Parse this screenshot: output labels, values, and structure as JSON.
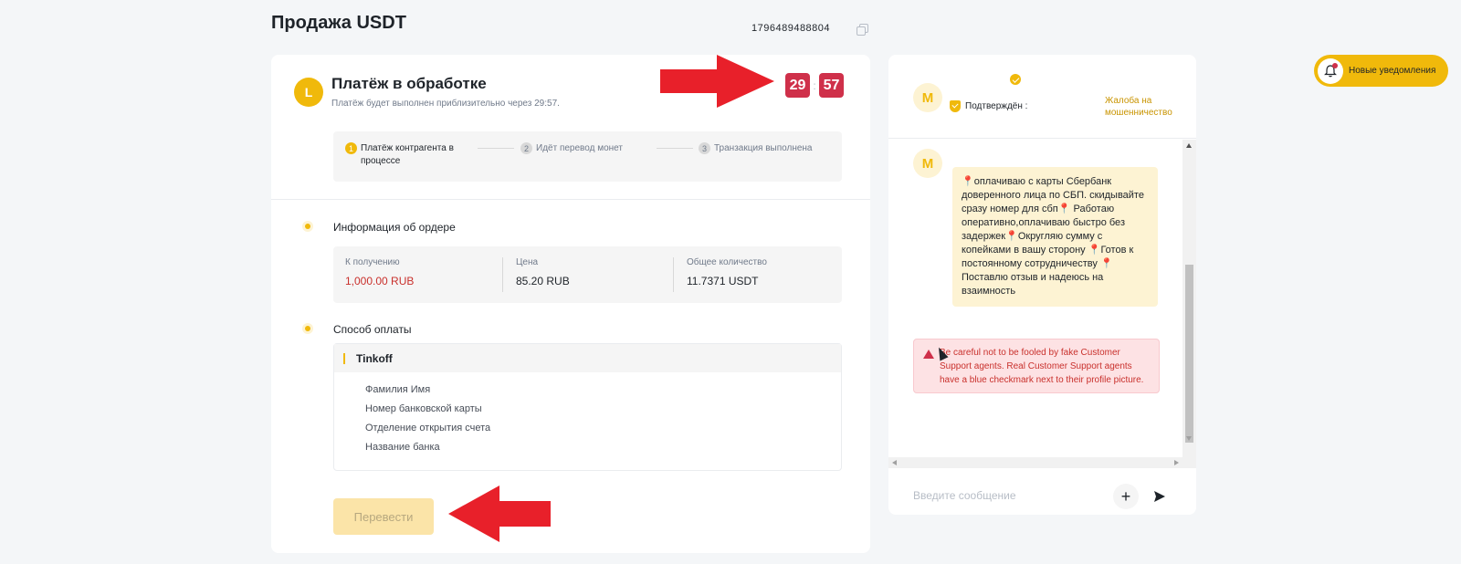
{
  "page": {
    "title": "Продажа USDT",
    "order_id": "1796489488804"
  },
  "status": {
    "avatar_letter": "L",
    "title": "Платёж в обработке",
    "subtitle": "Платёж будет выполнен приблизительно через 29:57.",
    "timer_minutes": "29",
    "timer_separator": ":",
    "timer_seconds": "57"
  },
  "steps": [
    {
      "num": "1",
      "label": "Платёж контрагента в процессе",
      "active": true
    },
    {
      "num": "2",
      "label": "Идёт перевод монет",
      "active": false
    },
    {
      "num": "3",
      "label": "Транзакция выполнена",
      "active": false
    }
  ],
  "order_info": {
    "title": "Информация об ордере",
    "receive_label": "К получению",
    "receive_value": "1,000.00 RUB",
    "price_label": "Цена",
    "price_value": "85.20 RUB",
    "total_label": "Общее количество",
    "total_value": "11.7371 USDT"
  },
  "payment": {
    "title": "Способ оплаты",
    "method": "Tinkoff",
    "fields": [
      "Фамилия Имя",
      "Номер банковской карты",
      "Отделение открытия счета",
      "Название банка"
    ]
  },
  "transfer_button": "Перевести",
  "chat": {
    "header_avatar": "M",
    "verified_label": "Подтверждён :",
    "complaint_link": "Жалоба на мошенничество",
    "message_avatar": "M",
    "message_parts": [
      "оплачиваю с карты Сбербанк доверенного лица по СБП. скидывайте сразу номер для сбп",
      "Работаю оперативно,оплачиваю быстро без задержек",
      "Округляю сумму с копейками в вашу сторону",
      "Готов к постоянному сотрудничеству",
      "Поставлю отзыв и надеюсь на взаимность"
    ],
    "pin_symbol": "📍",
    "warning": "Be careful not to be fooled by fake Customer Support agents. Real Customer Support agents have a blue checkmark next to their profile picture.",
    "input_placeholder": "Введите сообщение",
    "plus_label": "+"
  },
  "notifications": {
    "label": "Новые уведомления"
  },
  "colors": {
    "accent": "#f0b90b",
    "danger": "#cf304a",
    "arrow": "#e8202a"
  }
}
